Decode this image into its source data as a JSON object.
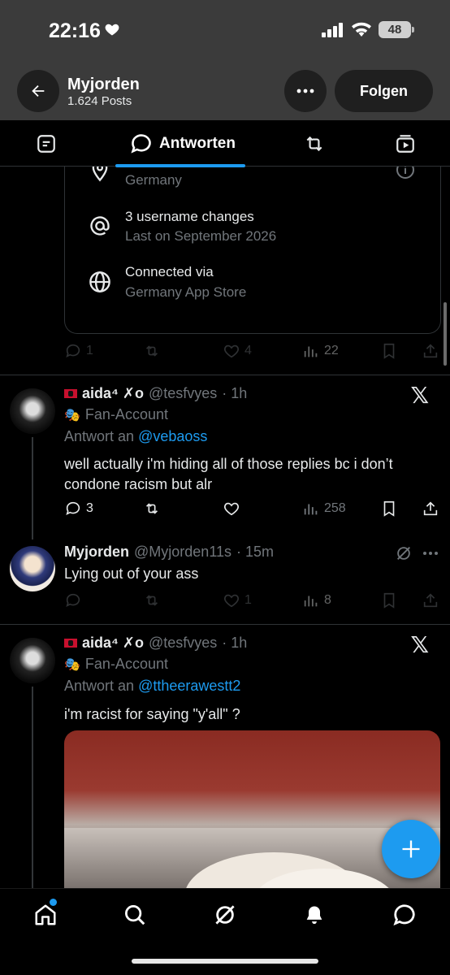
{
  "status_bar": {
    "time": "22:16",
    "battery": "48"
  },
  "header": {
    "name": "Myjorden",
    "posts": "1.624 Posts",
    "follow_label": "Folgen"
  },
  "tabs": {
    "active_label": "Antworten"
  },
  "about_card": {
    "location": "Germany",
    "username_changes": "3 username changes",
    "username_changes_sub": "Last on September 2026",
    "connected_title": "Connected via",
    "connected_sub": "Germany App Store",
    "stats": {
      "replies": "1",
      "likes": "4",
      "views": "22"
    }
  },
  "tweets": [
    {
      "name": "aida⁴ ✗o",
      "handle": "@tesfvyes",
      "time": "· 1h",
      "badge": "Fan-Account",
      "reply_prefix": "Antwort an",
      "reply_to": "@vebaoss",
      "text": "well actually i'm hiding all of those replies bc i don’t condone racism but alr",
      "replies": "3",
      "views": "258"
    },
    {
      "name": "Myjorden",
      "handle": "@Myjorden11s",
      "time": "· 15m",
      "text": "Lying out of your ass",
      "likes": "1",
      "views": "8"
    },
    {
      "name": "aida⁴ ✗o",
      "handle": "@tesfvyes",
      "time": "· 1h",
      "badge": "Fan-Account",
      "reply_prefix": "Antwort an",
      "reply_to": "@ttheerawestt2",
      "text": "i'm racist for saying \"y'all\" ?"
    }
  ],
  "colors": {
    "accent": "#1d9bf0",
    "background": "#000000",
    "muted": "#71767b",
    "header_overlay": "#3b3b3b"
  },
  "icons": [
    "heart-icon",
    "signal-icon",
    "wifi-icon",
    "back-arrow-icon",
    "more-icon",
    "posts-tab-icon",
    "reply-tab-icon",
    "repost-tab-icon",
    "media-tab-icon",
    "location-icon",
    "info-icon",
    "at-icon",
    "globe-icon",
    "reply-icon",
    "repost-icon",
    "like-icon",
    "views-icon",
    "bookmark-icon",
    "share-icon",
    "x-logo",
    "grok-icon",
    "plus-icon",
    "home-icon",
    "search-icon",
    "bell-icon",
    "messages-icon"
  ]
}
